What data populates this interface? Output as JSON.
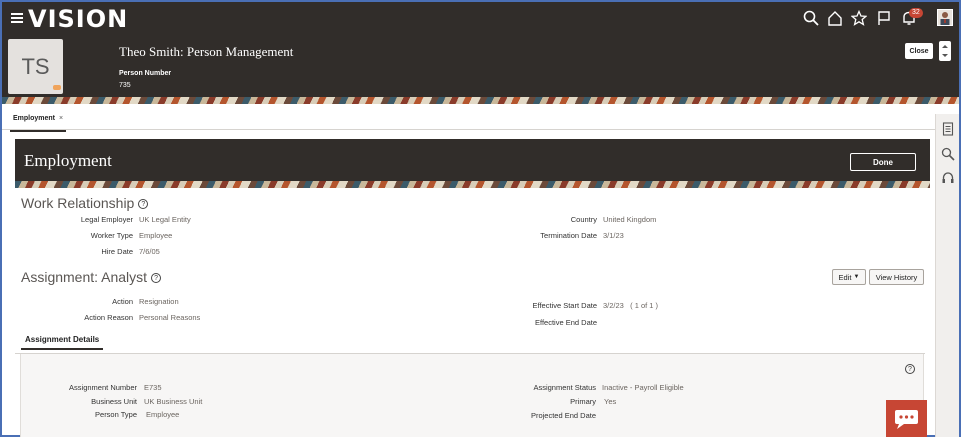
{
  "app": {
    "logo": "VISION"
  },
  "topbar": {
    "notifications_count": "32",
    "icons": [
      "search-icon",
      "home-icon",
      "star-icon",
      "flag-icon",
      "bell-icon"
    ]
  },
  "person": {
    "initials": "TS",
    "title": "Theo Smith: Person Management",
    "number_label": "Person Number",
    "number": "735",
    "close_label": "Close"
  },
  "tabs": [
    {
      "label": "Employment",
      "close": "×"
    }
  ],
  "page": {
    "title": "Employment",
    "done_label": "Done"
  },
  "work_relationship": {
    "title": "Work Relationship",
    "help": "?",
    "fields": {
      "legal_employer": {
        "label": "Legal Employer",
        "value": "UK Legal Entity"
      },
      "worker_type": {
        "label": "Worker Type",
        "value": "Employee"
      },
      "hire_date": {
        "label": "Hire Date",
        "value": "7/6/05"
      },
      "country": {
        "label": "Country",
        "value": "United Kingdom"
      },
      "termination_date": {
        "label": "Termination Date",
        "value": "3/1/23"
      }
    }
  },
  "assignment": {
    "title": "Assignment: Analyst",
    "help": "?",
    "edit_label": "Edit",
    "edit_caret": "▼",
    "view_history_label": "View History",
    "fields": {
      "action": {
        "label": "Action",
        "value": "Resignation"
      },
      "action_reason": {
        "label": "Action Reason",
        "value": "Personal Reasons"
      },
      "effective_start_date": {
        "label": "Effective Start Date",
        "value": "3/2/23",
        "pager": "( 1 of 1 )"
      },
      "effective_end_date": {
        "label": "Effective End Date",
        "value": ""
      }
    }
  },
  "details": {
    "tab_label": "Assignment Details",
    "help": "?",
    "fields": {
      "assignment_number": {
        "label": "Assignment Number",
        "value": "E735"
      },
      "business_unit": {
        "label": "Business Unit",
        "value": "UK Business Unit"
      },
      "person_type": {
        "label": "Person Type",
        "value": "Employee"
      },
      "assignment_status": {
        "label": "Assignment Status",
        "value": "Inactive - Payroll Eligible"
      },
      "primary": {
        "label": "Primary",
        "value": "Yes"
      },
      "projected_end_date": {
        "label": "Projected End Date",
        "value": ""
      }
    }
  },
  "colors": {
    "header_bg": "#312d2a",
    "accent_red": "#c74634",
    "link_gray": "#6b6560"
  }
}
